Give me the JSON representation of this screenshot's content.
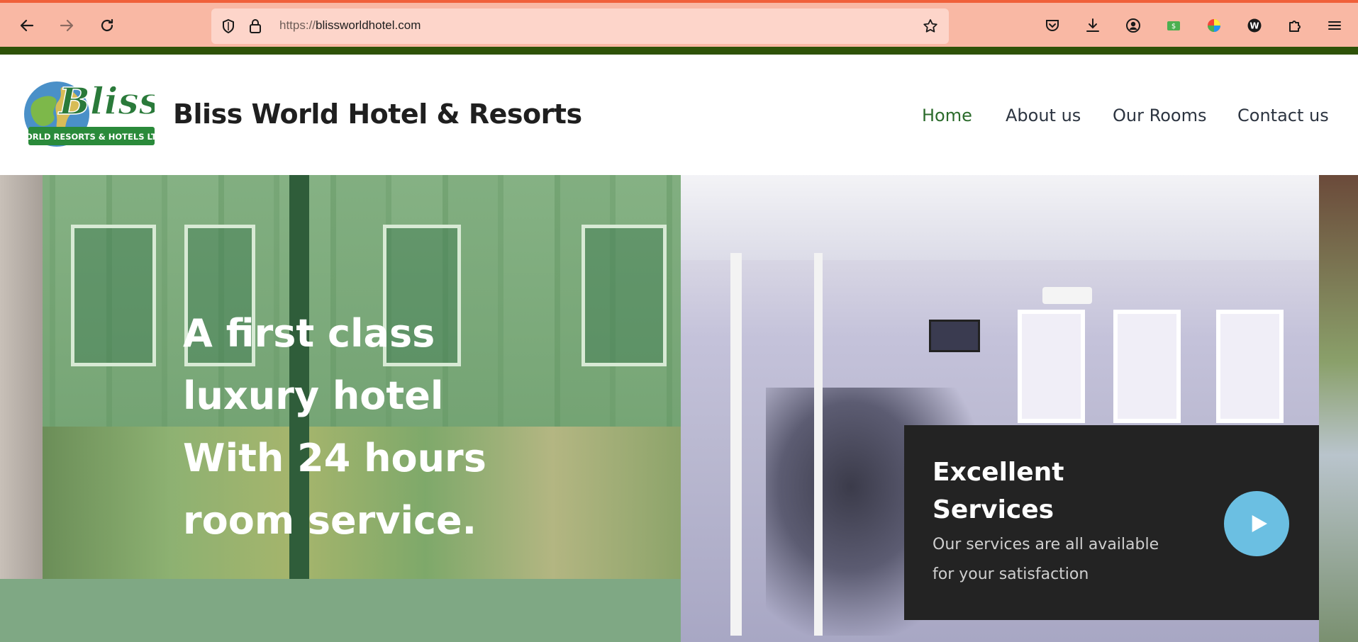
{
  "browser": {
    "url_protocol": "https://",
    "url_host": "blissworldhotel.com",
    "icons": [
      "back-icon",
      "forward-icon",
      "reload-icon",
      "shield-icon",
      "lock-icon",
      "star-icon",
      "pocket-icon",
      "download-icon",
      "account-icon",
      "extension-money-icon",
      "extension-color-icon",
      "extension-w-icon",
      "extensions-puzzle-icon",
      "menu-icon"
    ]
  },
  "site": {
    "logo_text_top": "Bliss",
    "logo_text_bottom": "WORLD RESORTS & HOTELS LTD.",
    "title": "Bliss World Hotel & Resorts",
    "nav": [
      {
        "label": "Home",
        "active": true
      },
      {
        "label": "About us",
        "active": false
      },
      {
        "label": "Our Rooms",
        "active": false
      },
      {
        "label": "Contact us",
        "active": false
      }
    ]
  },
  "hero": {
    "headline": "A first class luxury hotel With 24 hours room service.",
    "card": {
      "title": "Excellent Services",
      "description": "Our services are all available for your satisfaction",
      "play_icon": "play-icon"
    }
  },
  "colors": {
    "browser_bar": "#f9b8a4",
    "url_bar": "#fdd5ca",
    "accent_green": "#2e5208",
    "nav_active": "#2b6b2b",
    "card_bg": "#232323",
    "play_button": "#6bbfe2"
  }
}
